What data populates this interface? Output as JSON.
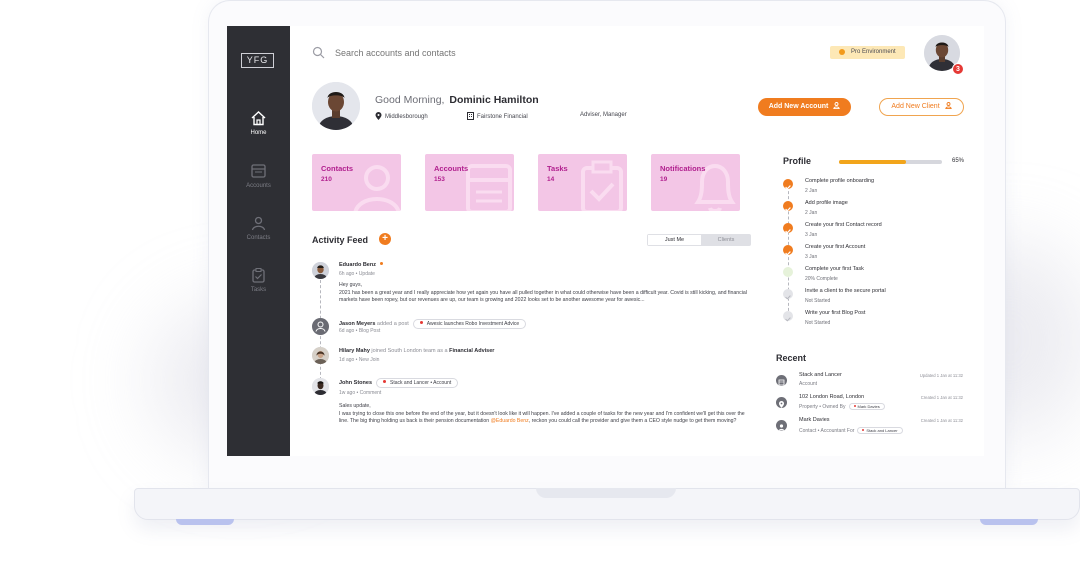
{
  "app": {
    "logo": "YFG"
  },
  "sidebar": {
    "items": [
      {
        "label": "Home",
        "icon": "home-icon"
      },
      {
        "label": "Accounts",
        "icon": "accounts-icon"
      },
      {
        "label": "Contacts",
        "icon": "contacts-icon"
      },
      {
        "label": "Tasks",
        "icon": "tasks-icon"
      }
    ]
  },
  "topbar": {
    "search_placeholder": "Search accounts and contacts",
    "environment": "Pro Environment",
    "notification_count": "3"
  },
  "header": {
    "greeting": "Good Morning,",
    "user_name": "Dominic Hamilton",
    "location": "Middlesborough",
    "company": "Fairstone Financial",
    "role": "Adviser, Manager",
    "add_account_label": "Add New Account",
    "add_client_label": "Add New Client"
  },
  "stats": [
    {
      "label": "Contacts",
      "count": "210"
    },
    {
      "label": "Accounts",
      "count": "153"
    },
    {
      "label": "Tasks",
      "count": "14"
    },
    {
      "label": "Notifications",
      "count": "19"
    }
  ],
  "activity": {
    "title": "Activity Feed",
    "tabs": [
      "Just Me",
      "Clients"
    ],
    "items": [
      {
        "name": "Eduardo Benz",
        "sub": "6h ago • Update",
        "body_1": "Hey guys,",
        "body_2": "2021 has been a great year and I really appreciate how yet again you have all pulled together in what could otherwise have been a difficult year. Covid is still kicking, and financial markets have been ropey, but our revenues are up, our team is growing and 2022 looks set to be another awesome year for awesic..."
      },
      {
        "name": "Jason Meyers",
        "action": "added a post",
        "tag": "Awesic launches Robo Investment Advice",
        "sub": "6d ago • Blog Post"
      },
      {
        "name": "Hilary Mahy",
        "action": "joined South London team as a",
        "role": "Financial Adviser",
        "sub": "1d ago • New Join"
      },
      {
        "name": "John Stones",
        "tag": "Stack and Lancer • Account",
        "sub": "1w ago • Comment",
        "body_1": "Sales update,",
        "body_2a": "I was trying to close this one before the end of the year, but it doesn't look like it will happen. I've added a couple of tasks for the new year and I'm confident we'll get this over the line. The big thing holding us back is their pension documentation",
        "mention": "@Eduardo Benz",
        "body_2b": ", reckon you could call the provider and give them a CEO style nudge to get them moving?"
      }
    ]
  },
  "profile": {
    "title": "Profile",
    "progress": 0.65,
    "progress_label": "65%",
    "steps": [
      {
        "title": "Complete profile onboarding",
        "sub": "2 Jan",
        "status": "done"
      },
      {
        "title": "Add profile image",
        "sub": "2 Jan",
        "status": "done"
      },
      {
        "title": "Create your first Contact record",
        "sub": "3 Jan",
        "status": "done"
      },
      {
        "title": "Create your first Account",
        "sub": "3 Jan",
        "status": "done"
      },
      {
        "title": "Complete your first Task",
        "sub": "20% Complete",
        "status": "partial"
      },
      {
        "title": "Invite a client to the secure portal",
        "sub": "Not Started",
        "status": "todo"
      },
      {
        "title": "Write your first Blog Post",
        "sub": "Not Started",
        "status": "todo"
      }
    ]
  },
  "recent": {
    "title": "Recent",
    "items": [
      {
        "name": "Stack and Lancer",
        "type": "Account",
        "updated": "Updated 1 Jan at 11:32"
      },
      {
        "name": "102 London Road, London",
        "type": "Property • Owned By",
        "chip": "Mark Davies",
        "updated": "Created 1 Jan at 11:32"
      },
      {
        "name": "Mark Davies",
        "type": "Contact • Accountant For",
        "chip": "Stack and Lancer",
        "updated": "Created 1 Jan at 11:32"
      }
    ]
  },
  "colors": {
    "accent": "#f07c1f",
    "card": "#f3c6e6",
    "card_text": "#b11f8e",
    "sidebar": "#2e2f34"
  }
}
